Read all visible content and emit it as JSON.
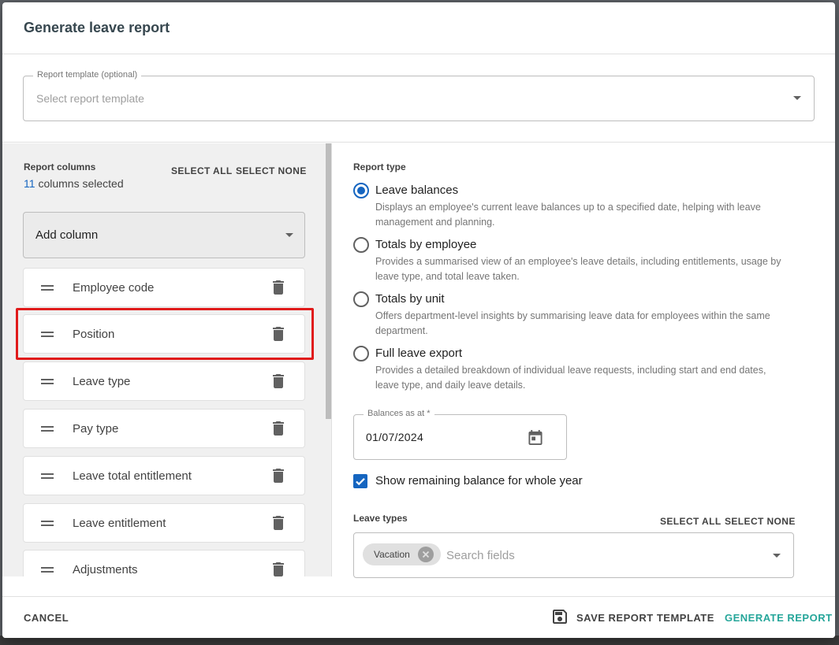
{
  "dialog": {
    "title": "Generate leave report"
  },
  "template": {
    "label": "Report template (optional)",
    "placeholder": "Select report template"
  },
  "columns": {
    "title": "Report columns",
    "count": "11",
    "count_suffix": "columns selected",
    "select_all": "SELECT ALL",
    "select_none": "SELECT NONE",
    "add_column": "Add column",
    "items": [
      {
        "label": "Employee code"
      },
      {
        "label": "Position"
      },
      {
        "label": "Leave type"
      },
      {
        "label": "Pay type"
      },
      {
        "label": "Leave total entitlement"
      },
      {
        "label": "Leave entitlement"
      },
      {
        "label": "Adjustments"
      }
    ]
  },
  "report_type": {
    "title": "Report type",
    "options": [
      {
        "label": "Leave balances",
        "desc": "Displays an employee's current leave balances up to a specified date, helping with leave management and planning.",
        "checked": true
      },
      {
        "label": "Totals by employee",
        "desc": "Provides a summarised view of an employee's leave details, including entitlements, usage by leave type, and total leave taken.",
        "checked": false
      },
      {
        "label": "Totals by unit",
        "desc": "Offers department-level insights by summarising leave data for employees within the same department.",
        "checked": false
      },
      {
        "label": "Full leave export",
        "desc": "Provides a detailed breakdown of individual leave requests, including start and end dates, leave type, and daily leave details.",
        "checked": false
      }
    ]
  },
  "balances": {
    "label": "Balances as at *",
    "value": "01/07/2024"
  },
  "remaining": {
    "label": "Show remaining balance for whole year",
    "checked": true
  },
  "leave_types": {
    "title": "Leave types",
    "select_all": "SELECT ALL",
    "select_none": "SELECT NONE",
    "chip": "Vacation",
    "placeholder": "Search fields"
  },
  "footer": {
    "cancel": "CANCEL",
    "save_template": "SAVE REPORT TEMPLATE",
    "generate": "GENERATE REPORT"
  },
  "colors": {
    "primary_blue": "#1565c0",
    "teal": "#26a69a",
    "highlight_red": "#e01b1b"
  }
}
